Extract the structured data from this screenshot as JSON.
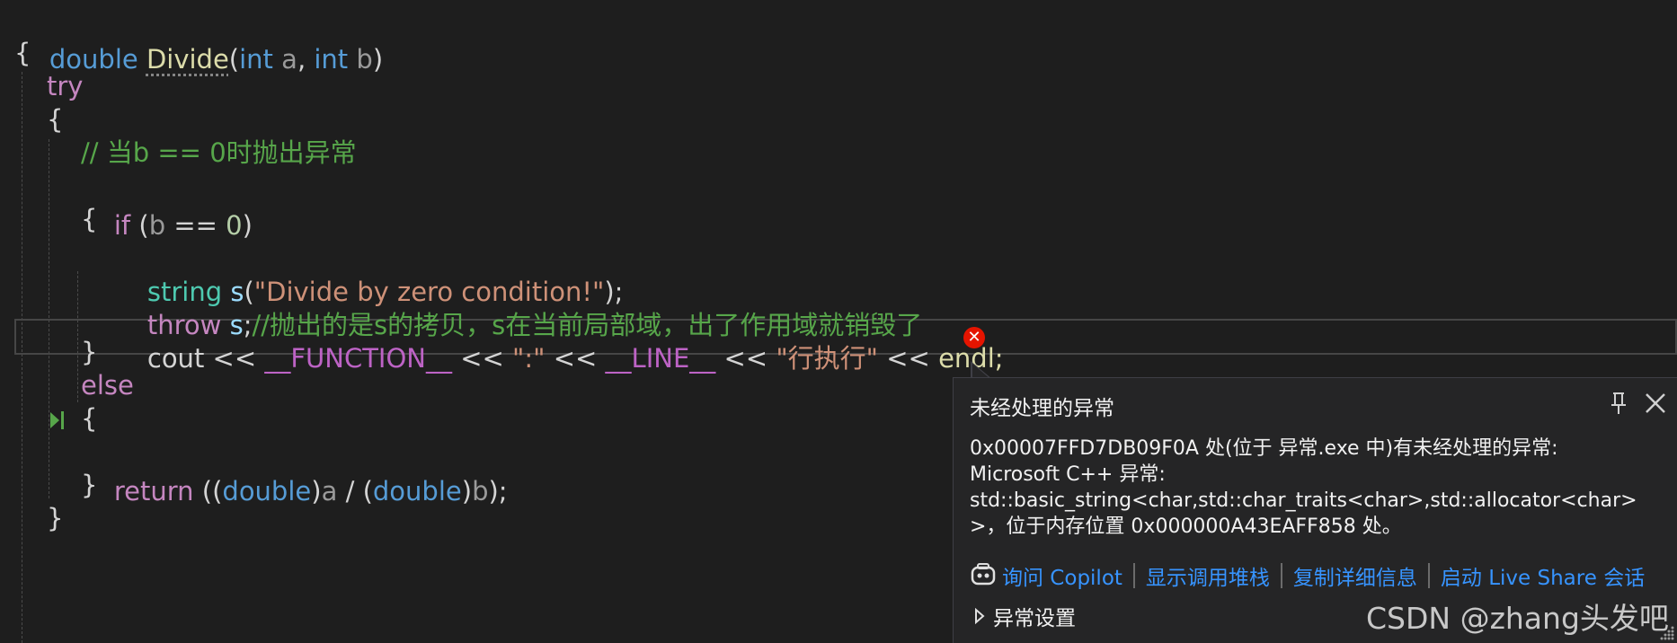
{
  "code": {
    "l1": {
      "ret": "double",
      "fn": "Divide",
      "open": "(",
      "t1": "int",
      "p1": "a",
      "comma": ", ",
      "t2": "int",
      "p2": "b",
      "close": ")"
    },
    "l2": "{",
    "l3": "try",
    "l4": "{",
    "l5": "// 当b == 0时抛出异常",
    "l6": {
      "kw": "if",
      "open": " (",
      "var": "b",
      "op": " == ",
      "num": "0",
      "close": ")"
    },
    "l7": "{",
    "l8": {
      "type": "string",
      "var": "s",
      "open": "(",
      "str": "\"Divide by zero condition!\"",
      "close": ");"
    },
    "l9": {
      "kw": "throw",
      "var": "s",
      "semi": ";",
      "cmt": "//抛出的是s的拷贝，s在当前局部域，出了作用域就销毁了"
    },
    "l10": {
      "cout": "cout",
      "op1": " << ",
      "m1": "__FUNCTION__",
      "op2": " << ",
      "s1": "\":\"",
      "op3": " << ",
      "m2": "__LINE__",
      "op4": " << ",
      "s2": "\"行执行\"",
      "op5": " << ",
      "endl": "endl;"
    },
    "l11": "}",
    "l12": "else",
    "l13": "{",
    "l14": {
      "kw": "return",
      "o1": " ((",
      "t1": "double",
      "c1": ")",
      "v1": "a",
      "op": " / (",
      "t2": "double",
      "c2": ")",
      "v2": "b",
      "end": ");"
    },
    "l15": "}",
    "l16": "}"
  },
  "popup": {
    "title": "未经处理的异常",
    "message_lines": [
      "0x00007FFD7DB09F0A 处(位于 异常.exe 中)有未经处理的异常:",
      "Microsoft C++ 异常:",
      "std::basic_string<char,std::char_traits<char>,std::allocator<char>",
      ">，位于内存位置 0x000000A43EAFF858 处。"
    ],
    "actions": {
      "ask_copilot": "询问 Copilot",
      "call_stack": "显示调用堆栈",
      "copy_details": "复制详细信息",
      "live_share": "启动 Live Share 会话"
    },
    "settings_label": "异常设置",
    "icons": [
      "pin-icon",
      "close-icon",
      "copilot-icon",
      "caret-right-icon"
    ]
  },
  "watermark": "CSDN @zhang头发吧",
  "colors": {
    "background": "#1e1e1e",
    "keyword": "#569cd6",
    "control": "#c586c0",
    "function": "#dcdcaa",
    "type": "#4ec9b0",
    "string": "#ce9178",
    "comment": "#57a64a",
    "error": "#e51400",
    "link": "#3794ff"
  }
}
